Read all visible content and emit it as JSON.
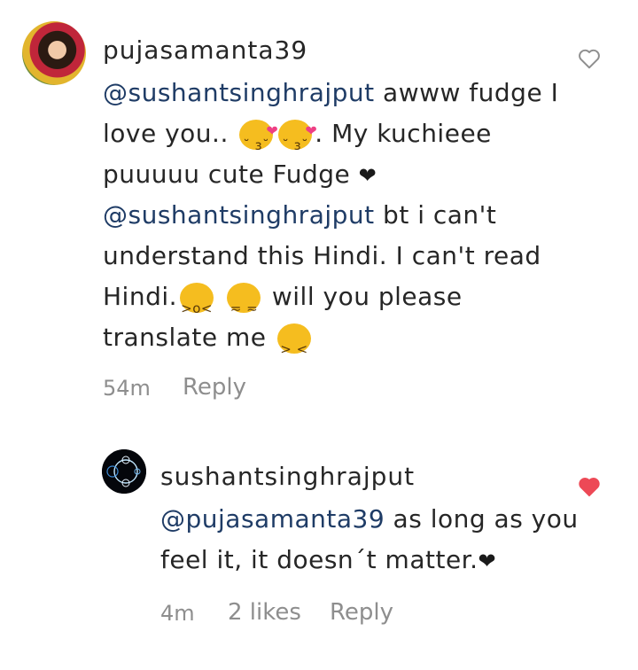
{
  "comments": [
    {
      "username": "pujasamanta39",
      "lines": [
        {
          "mention": "@sushantsinghrajput",
          "text": "  awww fudge I"
        },
        {
          "text": "love you..",
          "emojis": [
            "kissing-face-with-heart",
            "kissing-face-with-heart"
          ],
          "after": ". My kuchieee"
        },
        {
          "text": "puuuuu cute Fudge",
          "heart": "❤"
        },
        {
          "mention": "@sushantsinghrajput",
          "text": "  bt i can't"
        },
        {
          "text": "understand this Hindi. I can't read"
        },
        {
          "text": "Hindi.",
          "emojis": [
            "loudly-crying-face",
            "disappointed-face"
          ],
          "after": "will you please"
        },
        {
          "text": "translate me",
          "emojis": [
            "persevering-face"
          ]
        }
      ],
      "time": "54m",
      "reply_label": "Reply",
      "liked": false
    },
    {
      "username": "sushantsinghrajput",
      "lines": [
        {
          "mention": "@pujasamanta39",
          "text": " as long as you"
        },
        {
          "text": "feel it, it doesn´t matter.",
          "heart": "❤"
        }
      ],
      "time": "4m",
      "likes": "2 likes",
      "reply_label": "Reply",
      "liked": true
    }
  ],
  "colors": {
    "like_active": "#ed4956",
    "mention": "#1f3c66",
    "meta": "#8e8e8e"
  }
}
